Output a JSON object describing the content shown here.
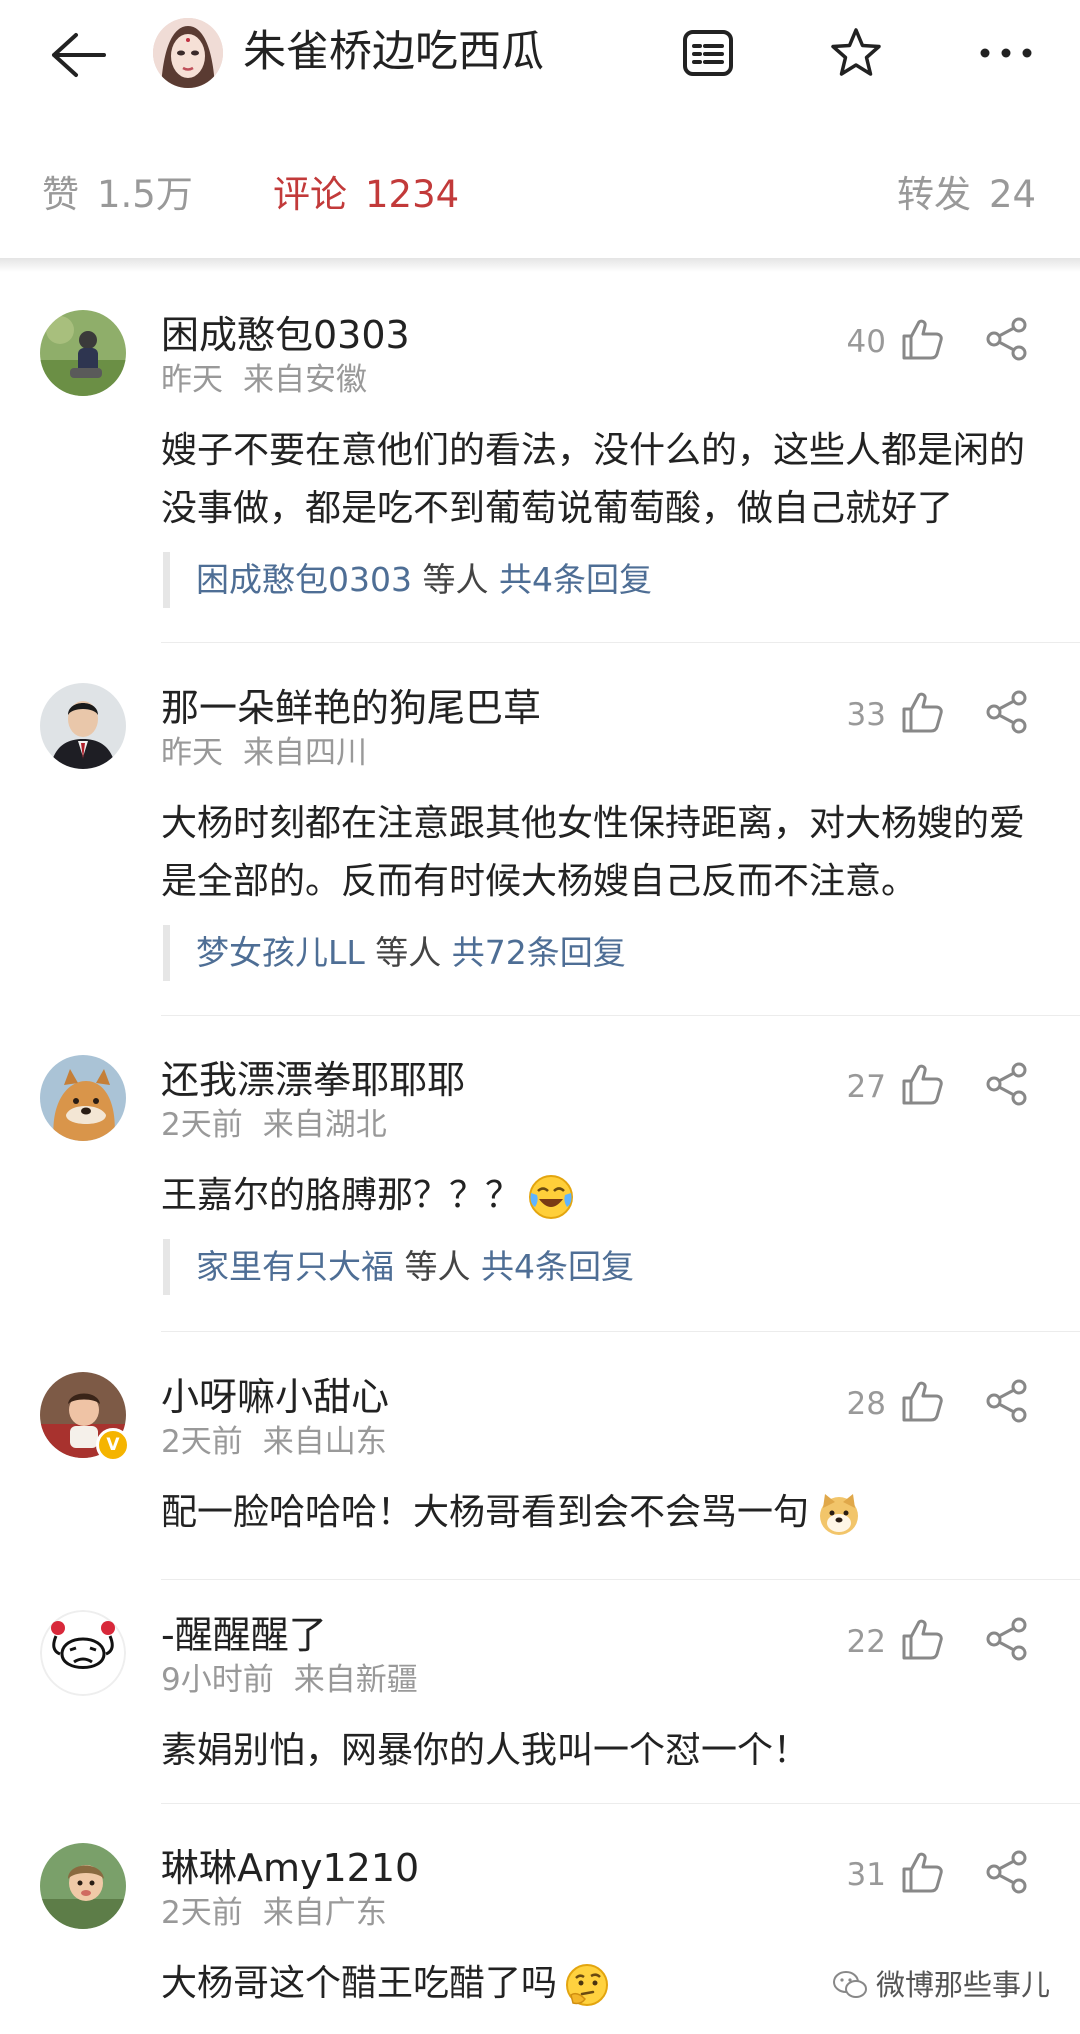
{
  "header": {
    "title": "朱雀桥边吃西瓜",
    "icons": [
      "back-arrow-icon",
      "list-icon",
      "star-icon",
      "more-icon"
    ]
  },
  "stats": {
    "likes_label": "赞",
    "likes_value": "1.5万",
    "comments_label": "评论",
    "comments_value": "1234",
    "reposts_label": "转发",
    "reposts_value": "24",
    "active_color": "#c23a3a"
  },
  "comments": [
    {
      "user": "困成憨包0303",
      "time": "昨天",
      "location": "来自安徽",
      "likes": "40",
      "text": "嫂子不要在意他们的看法，没什么的，这些人都是闲的没事做，都是吃不到葡萄说葡萄酸，做自己就好了",
      "reply_user": "困成憨包0303",
      "reply_mid": "等人",
      "reply_count": "共4条回复"
    },
    {
      "user": "那一朵鲜艳的狗尾巴草",
      "time": "昨天",
      "location": "来自四川",
      "likes": "33",
      "text": "大杨时刻都在注意跟其他女性保持距离，对大杨嫂的爱是全部的。反而有时候大杨嫂自己反而不注意。",
      "reply_user": "梦女孩儿LL",
      "reply_mid": "等人",
      "reply_count": "共72条回复"
    },
    {
      "user": "还我漂漂拳耶耶耶",
      "time": "2天前",
      "location": "来自湖北",
      "likes": "27",
      "text": "王嘉尔的胳膊那？？？",
      "emoji": "laugh-cry-emoji",
      "reply_user": "家里有只大福",
      "reply_mid": "等人",
      "reply_count": "共4条回复"
    },
    {
      "user": "小呀嘛小甜心",
      "time": "2天前",
      "location": "来自山东",
      "likes": "28",
      "text": "配一脸哈哈哈！大杨哥看到会不会骂一句",
      "emoji": "doge-emoji",
      "badge": "V"
    },
    {
      "user": "-醒醒醒了",
      "time": "9小时前",
      "location": "来自新疆",
      "likes": "22",
      "text": "素娟别怕，网暴你的人我叫一个怼一个！"
    },
    {
      "user": "琳琳Amy1210",
      "time": "2天前",
      "location": "来自广东",
      "likes": "31",
      "text": "大杨哥这个醋王吃醋了吗",
      "emoji": "thinking-emoji"
    }
  ],
  "watermark": "微博那些事儿"
}
